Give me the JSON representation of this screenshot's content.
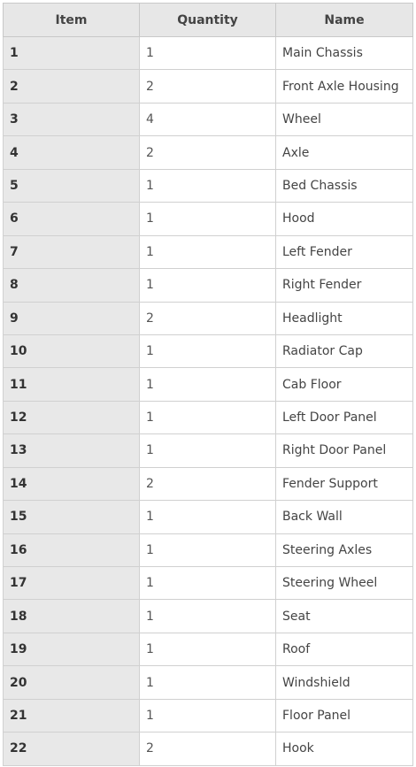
{
  "table": {
    "headers": {
      "item": "Item",
      "quantity": "Quantity",
      "name": "Name"
    },
    "rows": [
      {
        "item": "1",
        "quantity": "1",
        "name": "Main Chassis"
      },
      {
        "item": "2",
        "quantity": "2",
        "name": "Front Axle Housing"
      },
      {
        "item": "3",
        "quantity": "4",
        "name": "Wheel"
      },
      {
        "item": "4",
        "quantity": "2",
        "name": "Axle"
      },
      {
        "item": "5",
        "quantity": "1",
        "name": "Bed Chassis"
      },
      {
        "item": "6",
        "quantity": "1",
        "name": "Hood"
      },
      {
        "item": "7",
        "quantity": "1",
        "name": "Left Fender"
      },
      {
        "item": "8",
        "quantity": "1",
        "name": "Right Fender"
      },
      {
        "item": "9",
        "quantity": "2",
        "name": "Headlight"
      },
      {
        "item": "10",
        "quantity": "1",
        "name": "Radiator Cap"
      },
      {
        "item": "11",
        "quantity": "1",
        "name": "Cab Floor"
      },
      {
        "item": "12",
        "quantity": "1",
        "name": "Left Door Panel"
      },
      {
        "item": "13",
        "quantity": "1",
        "name": "Right Door Panel"
      },
      {
        "item": "14",
        "quantity": "2",
        "name": "Fender Support"
      },
      {
        "item": "15",
        "quantity": "1",
        "name": "Back Wall"
      },
      {
        "item": "16",
        "quantity": "1",
        "name": "Steering Axles"
      },
      {
        "item": "17",
        "quantity": "1",
        "name": "Steering Wheel"
      },
      {
        "item": "18",
        "quantity": "1",
        "name": "Seat"
      },
      {
        "item": "19",
        "quantity": "1",
        "name": "Roof"
      },
      {
        "item": "20",
        "quantity": "1",
        "name": "Windshield"
      },
      {
        "item": "21",
        "quantity": "1",
        "name": "Floor Panel"
      },
      {
        "item": "22",
        "quantity": "2",
        "name": "Hook"
      }
    ]
  }
}
